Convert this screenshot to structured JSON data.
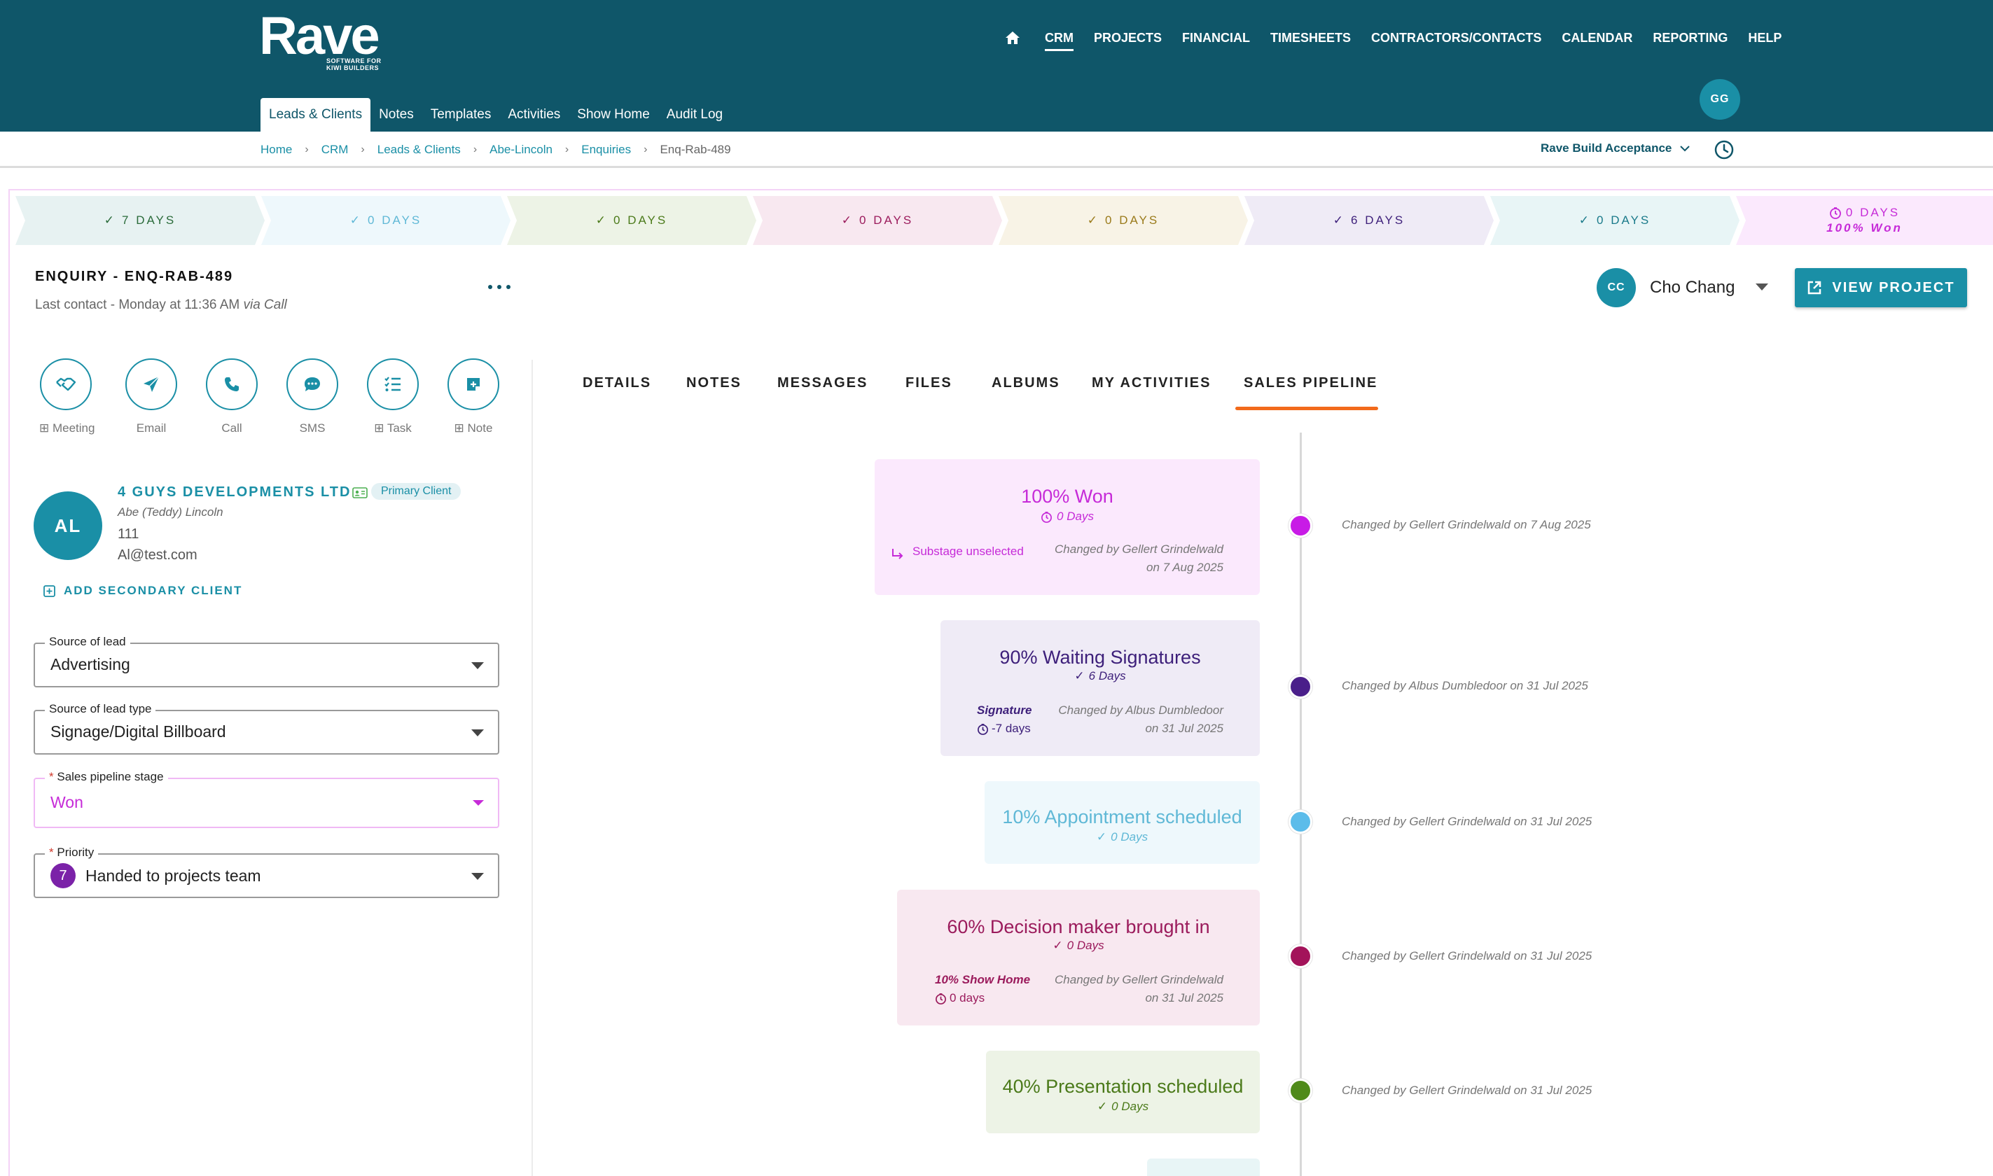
{
  "brand": {
    "logo_text": "Rave",
    "logo_subtitle_line1": "SOFTWARE FOR",
    "logo_subtitle_line2": "KIWI BUILDERS",
    "topbar_color": "#0f5669",
    "accent_color": "#1a8fa6"
  },
  "main_nav": {
    "home_icon": "home-icon",
    "items": [
      "CRM",
      "PROJECTS",
      "FINANCIAL",
      "TIMESHEETS",
      "CONTRACTORS/CONTACTS",
      "CALENDAR",
      "REPORTING",
      "HELP"
    ],
    "active": "CRM"
  },
  "sub_nav": {
    "items": [
      "Leads & Clients",
      "Notes",
      "Templates",
      "Activities",
      "Show Home",
      "Audit Log"
    ],
    "active": "Leads & Clients"
  },
  "user": {
    "initials": "GG"
  },
  "breadcrumb": {
    "items": [
      "Home",
      "CRM",
      "Leads & Clients",
      "Abe-Lincoln",
      "Enquiries",
      "Enq-Rab-489"
    ]
  },
  "environment": {
    "label": "Rave Build Acceptance"
  },
  "stages": [
    {
      "label": "7 DAYS",
      "icon": "check-icon",
      "color": "#2a6b3a",
      "bg": "#e7f2f2"
    },
    {
      "label": "0 DAYS",
      "icon": "check-icon",
      "color": "#5fb8d6",
      "bg": "#eef8fc"
    },
    {
      "label": "0 DAYS",
      "icon": "check-icon",
      "color": "#4b7a1a",
      "bg": "#edf3e6"
    },
    {
      "label": "0 DAYS",
      "icon": "check-icon",
      "color": "#9b1b5c",
      "bg": "#f8e8f0"
    },
    {
      "label": "0 DAYS",
      "icon": "check-icon",
      "color": "#9a7a1a",
      "bg": "#f8f3e6"
    },
    {
      "label": "6 DAYS",
      "icon": "check-icon",
      "color": "#3d1f7a",
      "bg": "#efebf6"
    },
    {
      "label": "0 DAYS",
      "icon": "check-icon",
      "color": "#1a7a8a",
      "bg": "#e8f5f6"
    },
    {
      "label": "0 DAYS",
      "sub": "100% Won",
      "icon": "timer-icon",
      "color": "#c62bd8",
      "bg": "#fbe9fd"
    }
  ],
  "enquiry": {
    "title": "ENQUIRY - ENQ-RAB-489",
    "last_contact_prefix": "Last contact - Monday at 11:36 AM",
    "last_contact_via": "via Call"
  },
  "assignee": {
    "initials": "CC",
    "name": "Cho Chang"
  },
  "view_project_label": "VIEW PROJECT",
  "quick_actions": [
    {
      "label": "⊞ Meeting",
      "icon": "handshake-icon"
    },
    {
      "label": "Email",
      "icon": "paper-plane-icon"
    },
    {
      "label": "Call",
      "icon": "phone-icon"
    },
    {
      "label": "SMS",
      "icon": "sms-icon"
    },
    {
      "label": "⊞ Task",
      "icon": "checklist-icon"
    },
    {
      "label": "⊞ Note",
      "icon": "note-icon"
    }
  ],
  "client": {
    "initials": "AL",
    "name": "4 GUYS DEVELOPMENTS LTD",
    "badge": "Primary Client",
    "contact": "Abe (Teddy) Lincoln",
    "phone": "111",
    "email": "Al@test.com",
    "add_secondary_label": "ADD SECONDARY CLIENT"
  },
  "fields": {
    "source_of_lead": {
      "label": "Source of lead",
      "value": "Advertising"
    },
    "source_of_lead_type": {
      "label": "Source of lead type",
      "value": "Signage/Digital Billboard"
    },
    "pipeline_stage": {
      "label": "Sales pipeline stage",
      "value": "Won",
      "required": "*"
    },
    "priority": {
      "label": "Priority",
      "number": "7",
      "value": "Handed to projects team",
      "required": "*"
    }
  },
  "tabs": {
    "items": [
      "DETAILS",
      "NOTES",
      "MESSAGES",
      "FILES",
      "ALBUMS",
      "MY ACTIVITIES",
      "SALES PIPELINE"
    ],
    "active": "SALES PIPELINE",
    "active_underline_color": "#f26a1b"
  },
  "timeline": [
    {
      "title": "100% Won",
      "days": "0 Days",
      "days_icon": "timer-icon",
      "color": "#c62bd8",
      "bg": "#fbe9fd",
      "dot": "#c81be6",
      "substage": "Substage unselected",
      "changed_line1": "Changed by Gellert Grindelwald",
      "changed_line2": "on 7 Aug 2025",
      "meta": "Changed by Gellert Grindelwald on 7 Aug 2025"
    },
    {
      "title": "90% Waiting Signatures",
      "days": "6 Days",
      "days_icon": "check-icon",
      "color": "#3d1f7a",
      "bg": "#efebf6",
      "dot": "#4a1f8a",
      "substage": "Signature",
      "substage_days": "-7 days",
      "changed_line1": "Changed by Albus Dumbledoor",
      "changed_line2": "on 31 Jul 2025",
      "meta": "Changed by Albus Dumbledoor on 31 Jul 2025"
    },
    {
      "title": "10% Appointment scheduled",
      "days": "0 Days",
      "days_icon": "check-icon",
      "color": "#5fb8d6",
      "bg": "#eef8fc",
      "dot": "#5cbcea",
      "meta": "Changed by Gellert Grindelwald on 31 Jul 2025"
    },
    {
      "title": "60% Decision maker brought in",
      "days": "0 Days",
      "days_icon": "check-icon",
      "color": "#9b1b5c",
      "bg": "#f8e8f0",
      "dot": "#a3135a",
      "substage": "10% Show Home",
      "substage_days": "0 days",
      "changed_line1": "Changed by Gellert Grindelwald",
      "changed_line2": "on 31 Jul 2025",
      "meta": "Changed by Gellert Grindelwald on 31 Jul 2025"
    },
    {
      "title": "40% Presentation scheduled",
      "days": "0 Days",
      "days_icon": "check-icon",
      "color": "#4b7a1a",
      "bg": "#edf3e6",
      "dot": "#4f8a1a",
      "meta": "Changed by Gellert Grindelwald on 31 Jul 2025"
    }
  ]
}
